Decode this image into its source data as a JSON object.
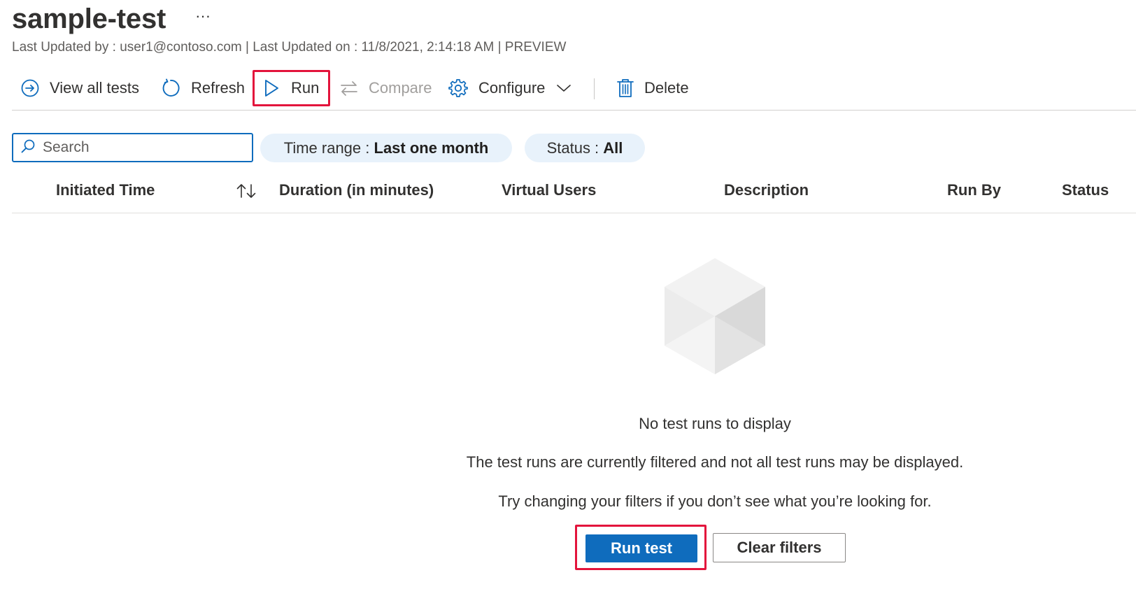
{
  "header": {
    "title": "sample-test",
    "more_icon": "ellipsis-icon",
    "more_label": "···",
    "subtitle": "Last Updated by : user1@contoso.com | Last Updated on : 11/8/2021, 2:14:18 AM | PREVIEW"
  },
  "toolbar": {
    "view_all_tests": "View all tests",
    "refresh": "Refresh",
    "run": "Run",
    "compare": "Compare",
    "configure": "Configure",
    "delete": "Delete"
  },
  "filters": {
    "search_placeholder": "Search",
    "time_range_label": "Time range : ",
    "time_range_value": "Last one month",
    "status_label": "Status : ",
    "status_value": "All"
  },
  "table": {
    "columns": [
      "Initiated Time",
      "Duration (in minutes)",
      "Virtual Users",
      "Description",
      "Run By",
      "Status"
    ]
  },
  "empty_state": {
    "title": "No test runs to display",
    "line1": "The test runs are currently filtered and not all test runs may be displayed.",
    "line2": "Try changing your filters if you don’t see what you’re looking for.",
    "run_test": "Run test",
    "clear_filters": "Clear filters"
  },
  "colors": {
    "accent": "#0f6cbd",
    "highlight": "#e3143c",
    "pill_bg": "#e8f2fb"
  }
}
